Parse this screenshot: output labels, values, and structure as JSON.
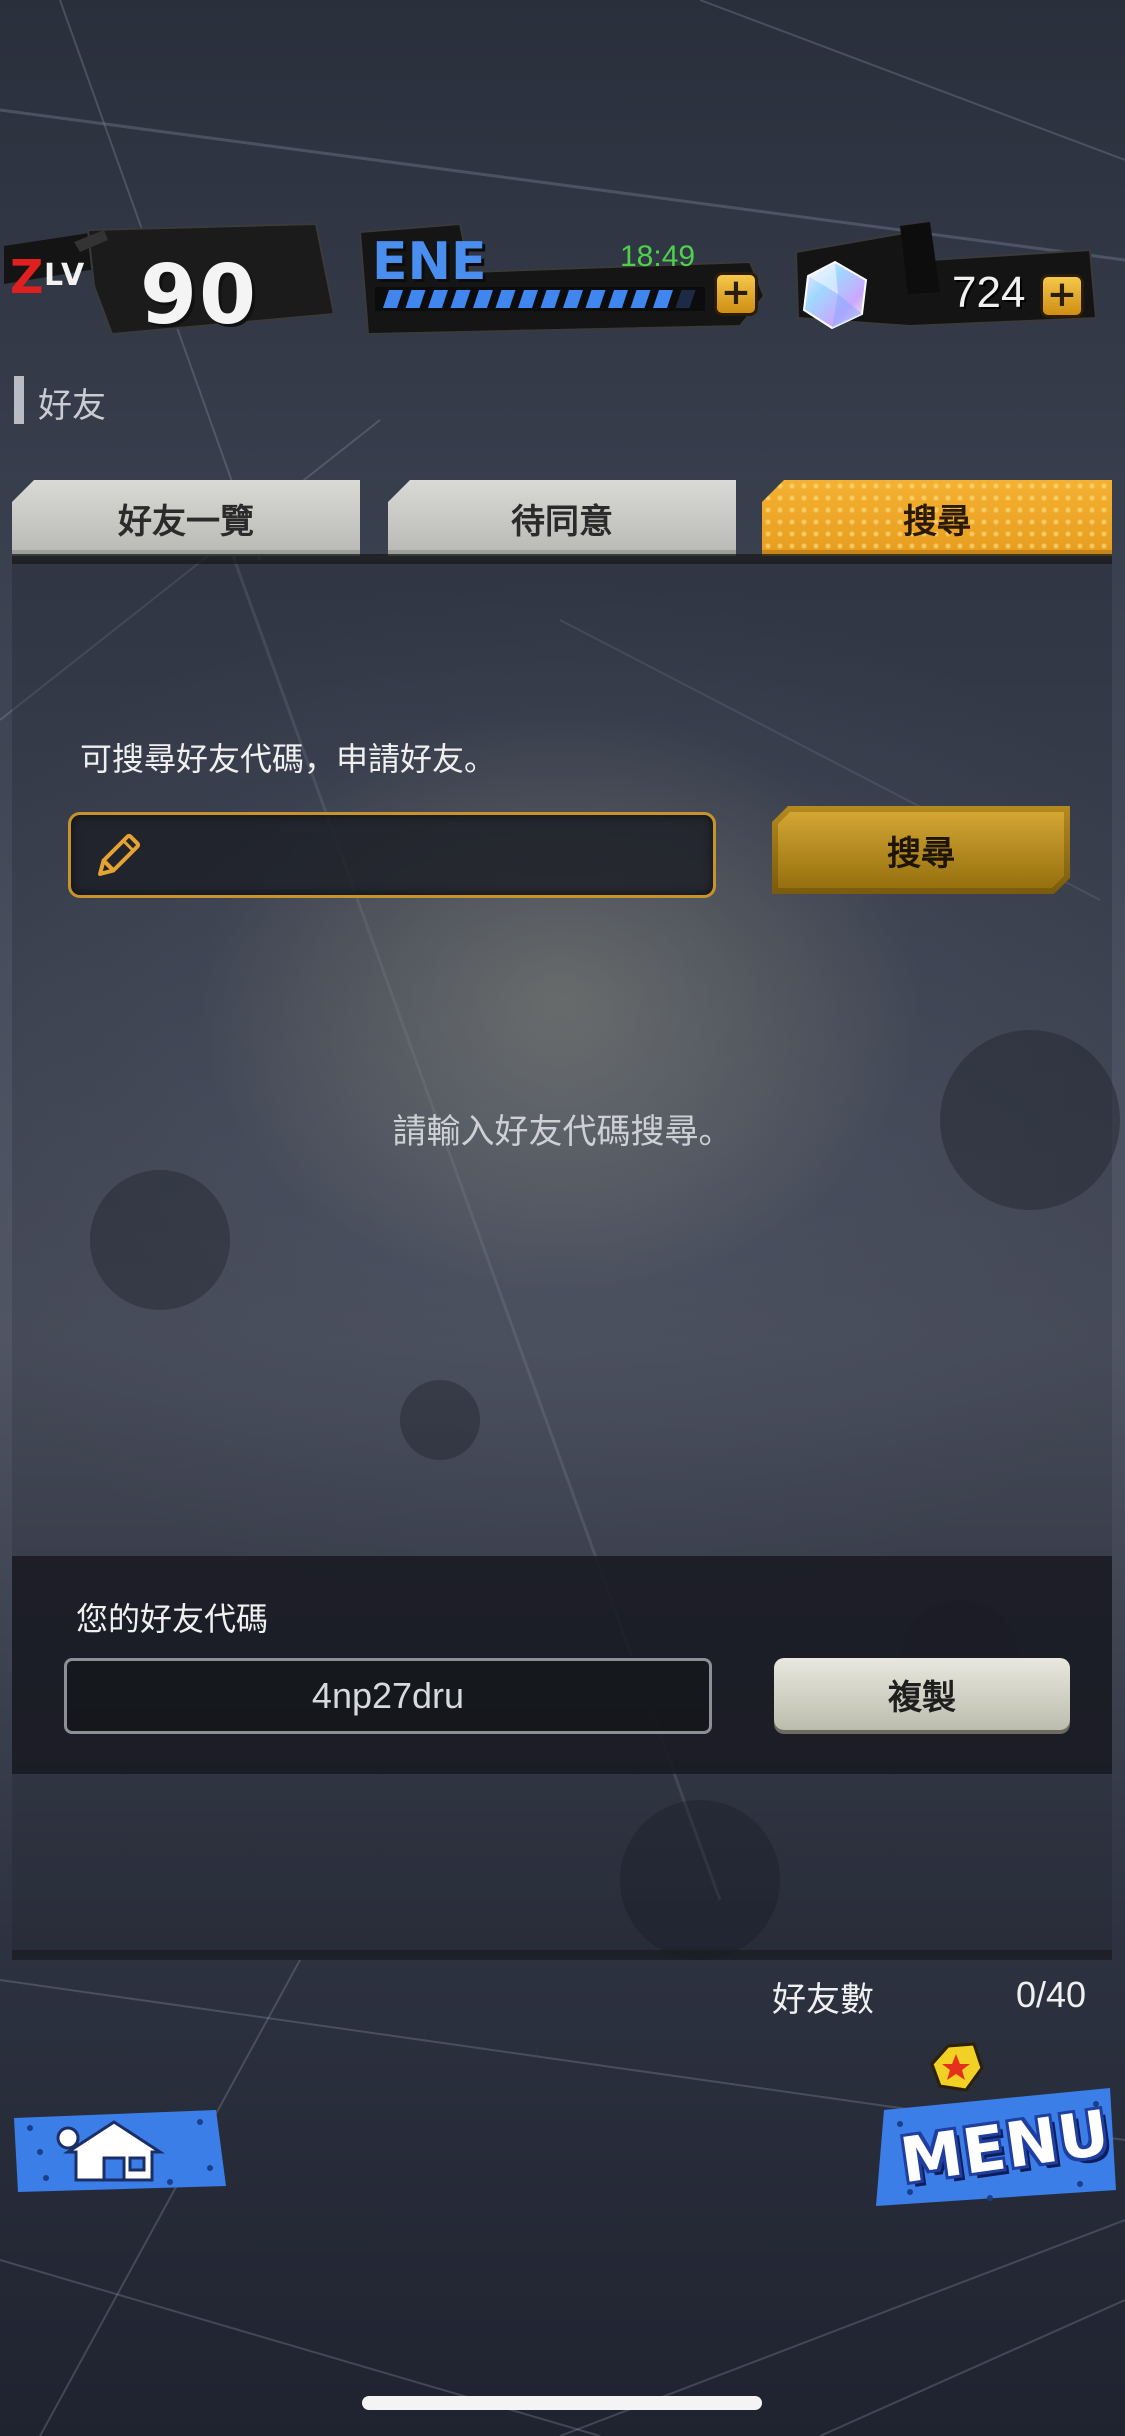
{
  "status_bar": {
    "level_prefix": "Z",
    "level_label": "LV",
    "level_value": "90",
    "energy_label": "ENE",
    "energy_timer": "18:49",
    "energy_fill": 0.93,
    "gem_count": "724",
    "plus_symbol": "+"
  },
  "page": {
    "title": "好友"
  },
  "tabs": [
    {
      "label": "好友一覽",
      "active": false
    },
    {
      "label": "待同意",
      "active": false
    },
    {
      "label": "搜尋",
      "active": true
    }
  ],
  "search": {
    "hint": "可搜尋好友代碼，申請好友。",
    "input_value": "",
    "button_label": "搜尋",
    "empty_message": "請輸入好友代碼搜尋。"
  },
  "friend_code": {
    "title": "您的好友代碼",
    "value": "4np27dru",
    "copy_label": "複製"
  },
  "friend_count": {
    "label": "好友數",
    "value": "0/40"
  },
  "nav": {
    "menu_label": "MENU"
  },
  "colors": {
    "accent_gold": "#e9a22a",
    "energy_blue": "#4a8ef0",
    "timer_green": "#4ed14a",
    "level_red": "#e0201e"
  },
  "icons": [
    "pencil-icon",
    "plus-icon",
    "gem-icon",
    "home-icon",
    "star-badge-icon"
  ]
}
